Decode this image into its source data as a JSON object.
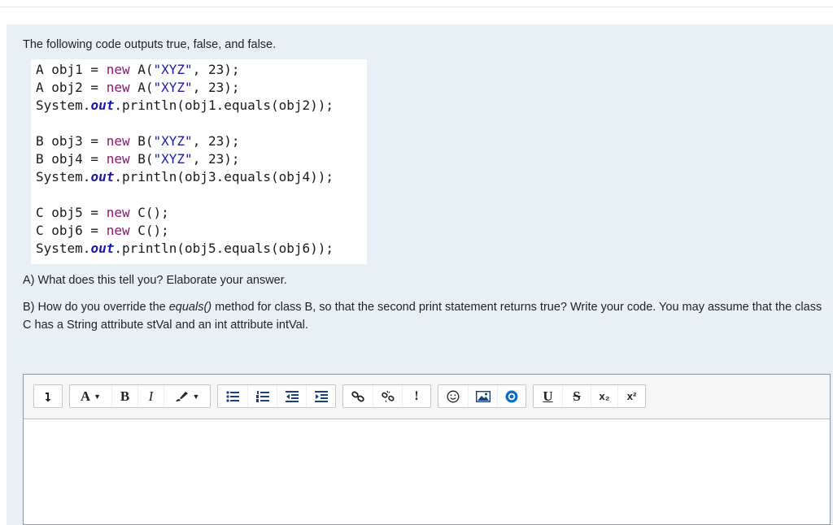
{
  "question": {
    "intro": "The following code outputs true, false, and false.",
    "code": {
      "blocks": [
        [
          [
            {
              "t": "A obj1 = "
            },
            {
              "t": "new",
              "c": "kw"
            },
            {
              "t": " A("
            },
            {
              "t": "\"XYZ\"",
              "c": "str"
            },
            {
              "t": ", 23);"
            }
          ],
          [
            {
              "t": "A obj2 = "
            },
            {
              "t": "new",
              "c": "kw"
            },
            {
              "t": " A("
            },
            {
              "t": "\"XYZ\"",
              "c": "str"
            },
            {
              "t": ", 23);"
            }
          ],
          [
            {
              "t": "System."
            },
            {
              "t": "out",
              "c": "fld"
            },
            {
              "t": ".println(obj1.equals(obj2));"
            }
          ]
        ],
        [
          [
            {
              "t": "B obj3 = "
            },
            {
              "t": "new",
              "c": "kw"
            },
            {
              "t": " B("
            },
            {
              "t": "\"XYZ\"",
              "c": "str"
            },
            {
              "t": ", 23);"
            }
          ],
          [
            {
              "t": "B obj4 = "
            },
            {
              "t": "new",
              "c": "kw"
            },
            {
              "t": " B("
            },
            {
              "t": "\"XYZ\"",
              "c": "str"
            },
            {
              "t": ", 23);"
            }
          ],
          [
            {
              "t": "System."
            },
            {
              "t": "out",
              "c": "fld"
            },
            {
              "t": ".println(obj3.equals(obj4));"
            }
          ]
        ],
        [
          [
            {
              "t": "C obj5 = "
            },
            {
              "t": "new",
              "c": "kw"
            },
            {
              "t": " C();"
            }
          ],
          [
            {
              "t": "C obj6 = "
            },
            {
              "t": "new",
              "c": "kw"
            },
            {
              "t": " C();"
            }
          ],
          [
            {
              "t": "System."
            },
            {
              "t": "out",
              "c": "fld"
            },
            {
              "t": ".println(obj5.equals(obj6));"
            }
          ]
        ]
      ]
    },
    "part_a": "A) What does this tell you? Elaborate your answer.",
    "part_b": {
      "before": "B) How do you override the ",
      "method": "equals()",
      "after": " method for class B, so that the second print statement returns true? Write your code.  You may assume that the class C has a String attribute stVal and an int attribute intVal."
    }
  },
  "editor": {
    "toolbar": {
      "text_color_label": "A",
      "bold_label": "B",
      "italic_label": "I",
      "warning_label": "!",
      "underline_label": "U",
      "strike_label": "S",
      "subscript_label": "x₂",
      "superscript_label": "x²"
    },
    "value": "",
    "colors": {
      "accent": "#0f6cbf",
      "toolbar_bg": "#f6f6f6",
      "panel_bg": "#e7f1f5"
    }
  }
}
